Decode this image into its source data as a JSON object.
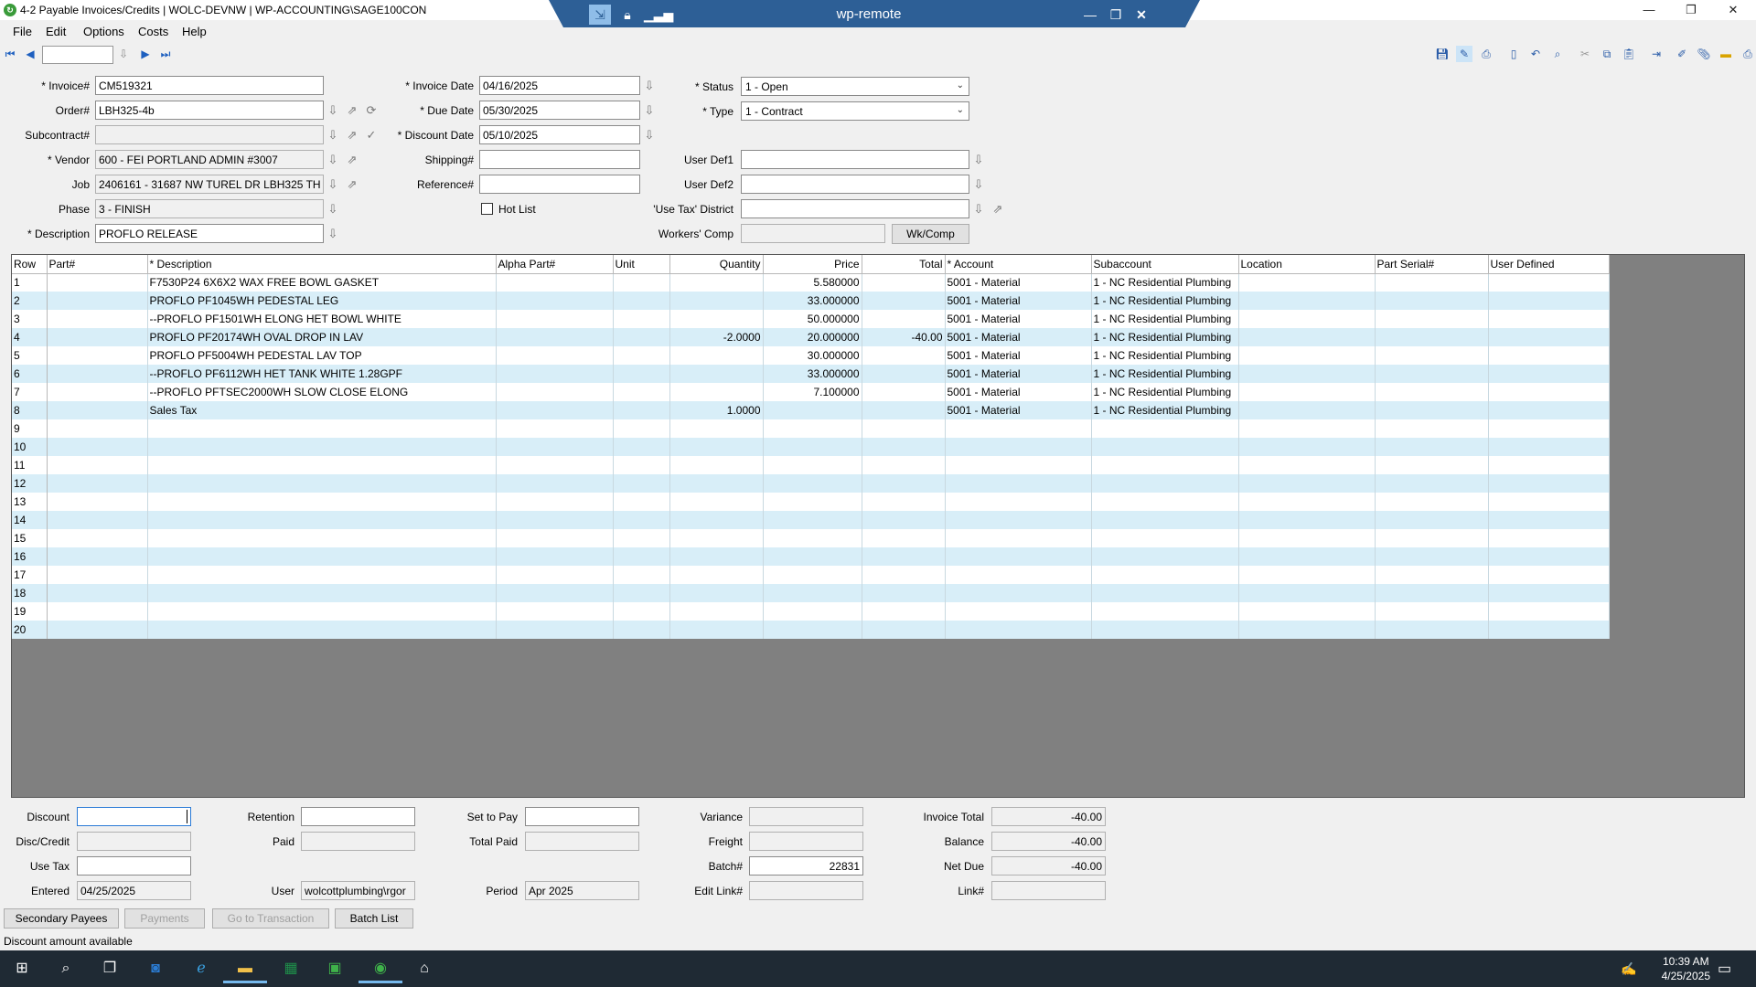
{
  "window": {
    "title": "4-2 Payable Invoices/Credits | WOLC-DEVNW | WP-ACCOUNTING\\SAGE100CON",
    "remote_title": "wp-remote"
  },
  "menu": [
    "File",
    "Edit",
    "Options",
    "Costs",
    "Help"
  ],
  "form": {
    "invoice_label": "* Invoice#",
    "invoice": "CM519321",
    "order_label": "Order#",
    "order": "LBH325-4b",
    "subcontract_label": "Subcontract#",
    "subcontract": "",
    "vendor_label": "* Vendor",
    "vendor": "600 - FEI PORTLAND ADMIN #3007",
    "job_label": "Job",
    "job": "2406161 - 31687 NW TUREL DR  LBH325 TH",
    "phase_label": "Phase",
    "phase": "3 - FINISH",
    "description_label": "* Description",
    "description": "PROFLO RELEASE",
    "invoice_date_label": "* Invoice Date",
    "invoice_date": "04/16/2025",
    "due_date_label": "* Due Date",
    "due_date": "05/30/2025",
    "discount_date_label": "* Discount Date",
    "discount_date": "05/10/2025",
    "shipping_label": "Shipping#",
    "shipping": "",
    "reference_label": "Reference#",
    "reference": "",
    "hot_list_label": "Hot List",
    "status_label": "* Status",
    "status": "1 - Open",
    "type_label": "* Type",
    "type": "1 - Contract",
    "user_def1_label": "User Def1",
    "user_def1": "",
    "user_def2_label": "User Def2",
    "user_def2": "",
    "use_tax_district_label": "'Use Tax' District",
    "use_tax_district": "",
    "workers_comp_label": "Workers' Comp",
    "workers_comp": "",
    "wkcomp_button": "Wk/Comp"
  },
  "grid": {
    "columns": [
      "Row",
      "Part#",
      "* Description",
      "Alpha Part#",
      "Unit",
      "Quantity",
      "Price",
      "Total",
      "* Account",
      "Subaccount",
      "Location",
      "Part Serial#",
      "User Defined"
    ],
    "rows": [
      [
        "1",
        "",
        "F7530P24 6X6X2 WAX FREE BOWL GASKET",
        "",
        "",
        "",
        "5.580000",
        "",
        "5001 - Material",
        "1 - NC Residential Plumbing",
        "",
        "",
        ""
      ],
      [
        "2",
        "",
        "PROFLO PF1045WH PEDESTAL LEG",
        "",
        "",
        "",
        "33.000000",
        "",
        "5001 - Material",
        "1 - NC Residential Plumbing",
        "",
        "",
        ""
      ],
      [
        "3",
        "",
        "--PROFLO PF1501WH ELONG HET BOWL WHITE",
        "",
        "",
        "",
        "50.000000",
        "",
        "5001 - Material",
        "1 - NC Residential Plumbing",
        "",
        "",
        ""
      ],
      [
        "4",
        "",
        "PROFLO PF20174WH OVAL DROP IN LAV",
        "",
        "",
        "-2.0000",
        "20.000000",
        "-40.00",
        "5001 - Material",
        "1 - NC Residential Plumbing",
        "",
        "",
        ""
      ],
      [
        "5",
        "",
        "PROFLO PF5004WH PEDESTAL LAV TOP",
        "",
        "",
        "",
        "30.000000",
        "",
        "5001 - Material",
        "1 - NC Residential Plumbing",
        "",
        "",
        ""
      ],
      [
        "6",
        "",
        "--PROFLO PF6112WH HET TANK WHITE 1.28GPF",
        "",
        "",
        "",
        "33.000000",
        "",
        "5001 - Material",
        "1 - NC Residential Plumbing",
        "",
        "",
        ""
      ],
      [
        "7",
        "",
        "--PROFLO PFTSEC2000WH SLOW CLOSE ELONG",
        "",
        "",
        "",
        "7.100000",
        "",
        "5001 - Material",
        "1 - NC Residential Plumbing",
        "",
        "",
        ""
      ],
      [
        "8",
        "",
        "Sales Tax",
        "",
        "",
        "1.0000",
        "",
        "",
        "5001 - Material",
        "1 - NC Residential Plumbing",
        "",
        "",
        ""
      ],
      [
        "9",
        "",
        "",
        "",
        "",
        "",
        "",
        "",
        "",
        "",
        "",
        "",
        ""
      ],
      [
        "10",
        "",
        "",
        "",
        "",
        "",
        "",
        "",
        "",
        "",
        "",
        "",
        ""
      ],
      [
        "11",
        "",
        "",
        "",
        "",
        "",
        "",
        "",
        "",
        "",
        "",
        "",
        ""
      ],
      [
        "12",
        "",
        "",
        "",
        "",
        "",
        "",
        "",
        "",
        "",
        "",
        "",
        ""
      ],
      [
        "13",
        "",
        "",
        "",
        "",
        "",
        "",
        "",
        "",
        "",
        "",
        "",
        ""
      ],
      [
        "14",
        "",
        "",
        "",
        "",
        "",
        "",
        "",
        "",
        "",
        "",
        "",
        ""
      ],
      [
        "15",
        "",
        "",
        "",
        "",
        "",
        "",
        "",
        "",
        "",
        "",
        "",
        ""
      ],
      [
        "16",
        "",
        "",
        "",
        "",
        "",
        "",
        "",
        "",
        "",
        "",
        "",
        ""
      ],
      [
        "17",
        "",
        "",
        "",
        "",
        "",
        "",
        "",
        "",
        "",
        "",
        "",
        ""
      ],
      [
        "18",
        "",
        "",
        "",
        "",
        "",
        "",
        "",
        "",
        "",
        "",
        "",
        ""
      ],
      [
        "19",
        "",
        "",
        "",
        "",
        "",
        "",
        "",
        "",
        "",
        "",
        "",
        ""
      ],
      [
        "20",
        "",
        "",
        "",
        "",
        "",
        "",
        "",
        "",
        "",
        "",
        "",
        ""
      ]
    ]
  },
  "footer": {
    "discount_label": "Discount",
    "discount": "",
    "disc_credit_label": "Disc/Credit",
    "disc_credit": "",
    "use_tax_label": "Use Tax",
    "use_tax": "",
    "entered_label": "Entered",
    "entered": "04/25/2025",
    "retention_label": "Retention",
    "retention": "",
    "paid_label": "Paid",
    "paid": "",
    "user_label": "User",
    "user": "wolcottplumbing\\rgor",
    "set_to_pay_label": "Set to Pay",
    "set_to_pay": "",
    "total_paid_label": "Total Paid",
    "total_paid": "",
    "period_label": "Period",
    "period": "Apr 2025",
    "variance_label": "Variance",
    "variance": "",
    "freight_label": "Freight",
    "freight": "",
    "batch_label": "Batch#",
    "batch": "22831",
    "edit_link_label": "Edit Link#",
    "edit_link": "",
    "invoice_total_label": "Invoice Total",
    "invoice_total": "-40.00",
    "balance_label": "Balance",
    "balance": "-40.00",
    "net_due_label": "Net Due",
    "net_due": "-40.00",
    "link_label": "Link#",
    "link": "",
    "buttons": {
      "secondary_payees": "Secondary Payees",
      "payments": "Payments",
      "go_to_transaction": "Go to Transaction",
      "batch_list": "Batch List"
    }
  },
  "status_text": "Discount amount available",
  "taskbar": {
    "time": "10:39 AM",
    "date": "4/25/2025"
  },
  "icons": {
    "app": "sage-app-icon",
    "taskbar": [
      "windows-start-icon",
      "search-icon",
      "task-view-icon",
      "outlook-icon",
      "edge-icon",
      "file-explorer-icon",
      "excel-icon",
      "sage-icon",
      "sage-timberline-icon",
      "remote-app-icon"
    ]
  }
}
